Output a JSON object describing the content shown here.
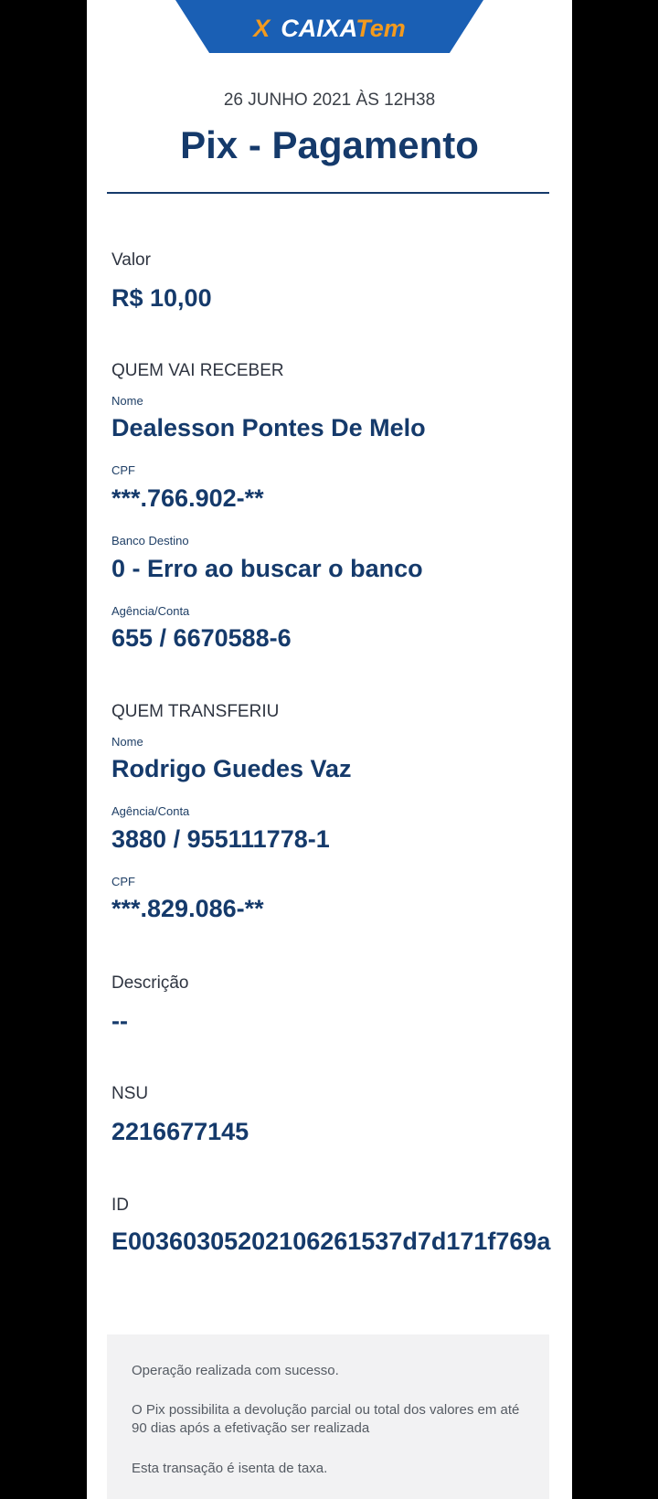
{
  "header": {
    "logo_x": "X",
    "logo_word": "CAIXA",
    "logo_tem": "Tem",
    "date": "26 JUNHO 2021 ÀS 12H38",
    "title": "Pix - Pagamento"
  },
  "valor": {
    "label": "Valor",
    "value": "R$ 10,00"
  },
  "recebedor": {
    "section": "QUEM VAI RECEBER",
    "nome_label": "Nome",
    "nome": "Dealesson Pontes De Melo",
    "cpf_label": "CPF",
    "cpf": "***.766.902-**",
    "banco_label": "Banco Destino",
    "banco": "0 - Erro ao buscar o banco",
    "agencia_label": "Agência/Conta",
    "agencia": "655 / 6670588-6"
  },
  "pagador": {
    "section": "QUEM TRANSFERIU",
    "nome_label": "Nome",
    "nome": "Rodrigo Guedes Vaz",
    "agencia_label": "Agência/Conta",
    "agencia": "3880 / 955111778-1",
    "cpf_label": "CPF",
    "cpf": "***.829.086-**"
  },
  "descricao": {
    "label": "Descrição",
    "value": "--"
  },
  "nsu": {
    "label": "NSU",
    "value": "2216677145"
  },
  "id": {
    "label": "ID",
    "value": "E00360305202106261537d7d171f769a"
  },
  "footer": {
    "line1": "Operação realizada com sucesso.",
    "line2": "O Pix possibilita a devolução parcial ou total dos valores em até 90 dias após a efetivação ser realizada",
    "line3": "Esta transação é isenta de taxa."
  },
  "colors": {
    "brand_blue": "#1a5fb4",
    "brand_orange": "#f39a1e",
    "text_navy": "#153a6b"
  }
}
